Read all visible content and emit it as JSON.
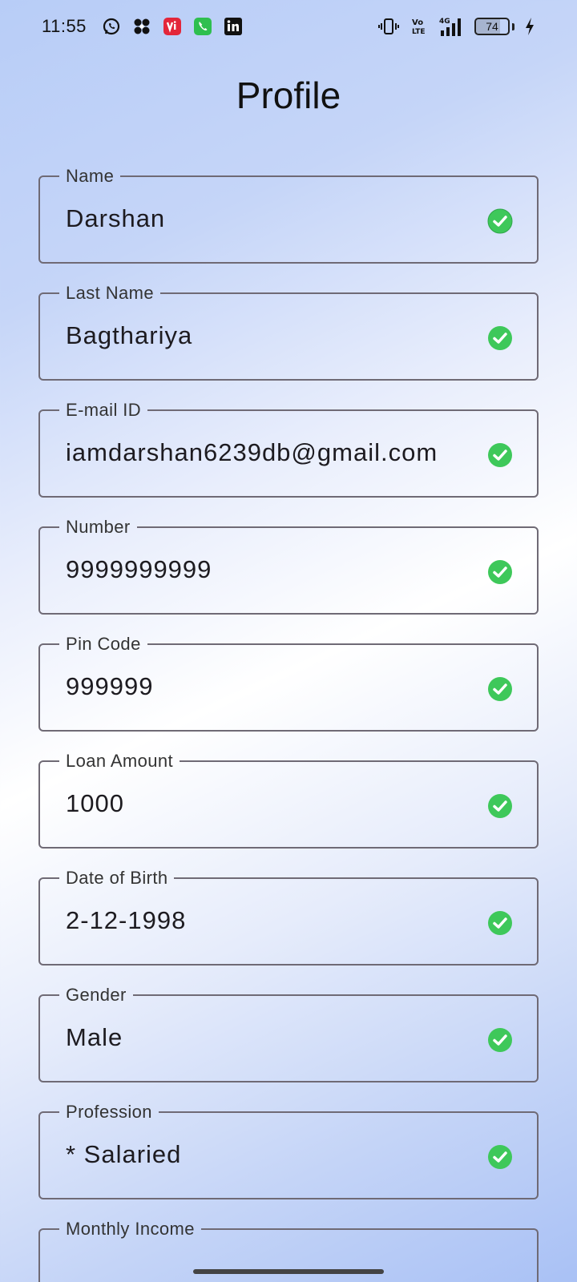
{
  "status_bar": {
    "time": "11:55",
    "battery_level": "74",
    "network": "4G",
    "volte": "Vo LTE",
    "left_icons": [
      "whatsapp-icon",
      "pinwheel-app-icon",
      "vi-app-icon",
      "phone-app-icon",
      "linkedin-icon"
    ],
    "right_icons": [
      "vibrate-icon",
      "volte-icon",
      "signal-icon",
      "battery-icon",
      "charging-icon"
    ]
  },
  "header": {
    "title": "Profile"
  },
  "form": {
    "fields": [
      {
        "label": "Name",
        "value": "Darshan",
        "valid": true
      },
      {
        "label": "Last Name",
        "value": "Bagthariya",
        "valid": true
      },
      {
        "label": "E-mail ID",
        "value": "iamdarshan6239db@gmail.com",
        "valid": true
      },
      {
        "label": "Number",
        "value": "9999999999",
        "valid": true
      },
      {
        "label": "Pin Code",
        "value": "999999",
        "valid": true
      },
      {
        "label": "Loan Amount",
        "value": "1000",
        "valid": true
      },
      {
        "label": "Date of Birth",
        "value": "2-12-1998",
        "valid": true
      },
      {
        "label": "Gender",
        "value": "Male",
        "valid": true
      },
      {
        "label": "Profession",
        "value": "* Salaried",
        "valid": true
      },
      {
        "label": "Monthly Income",
        "value": "",
        "valid": false
      }
    ]
  },
  "colors": {
    "check_green": "#3ec85a",
    "border": "#6f6a75",
    "text": "#1d1b20"
  }
}
